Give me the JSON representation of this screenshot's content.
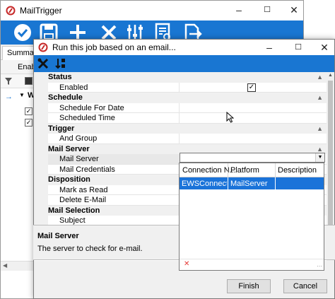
{
  "bg_window": {
    "title": "MailTrigger",
    "tab": "Summary",
    "enable_label": "Enabl",
    "group_letter": "W",
    "colors": {
      "toolbar": "#1976d2"
    }
  },
  "dialog": {
    "title": "Run this job based on an email...",
    "categories": {
      "status": "Status",
      "schedule": "Schedule",
      "trigger": "Trigger",
      "mail_server": "Mail Server",
      "disposition": "Disposition",
      "mail_selection": "Mail Selection"
    },
    "properties": {
      "enabled": "Enabled",
      "schedule_for_date": "Schedule For Date",
      "scheduled_time": "Scheduled Time",
      "and_group": "And Group",
      "mail_server": "Mail Server",
      "mail_credentials": "Mail Credentials",
      "mark_as_read": "Mark as Read",
      "delete_email": "Delete E-Mail",
      "subject": "Subject"
    },
    "enabled_value": true,
    "description": {
      "title": "Mail Server",
      "text": "The server to check for e-mail."
    },
    "buttons": {
      "finish": "Finish",
      "cancel": "Cancel"
    }
  },
  "dropdown": {
    "columns": [
      "Connection N...",
      "Platform",
      "Description"
    ],
    "rows": [
      {
        "connection": "EWSConnecti...",
        "platform": "MailServer",
        "description": ""
      }
    ],
    "selection_color": "#1a73d9"
  },
  "icons": {
    "toolbar": [
      "check-icon",
      "save-icon",
      "add-icon",
      "delete-icon",
      "sliders-icon",
      "report-icon",
      "export-icon"
    ],
    "dialog_toolbar": [
      "tools-icon",
      "sort-icon"
    ]
  }
}
